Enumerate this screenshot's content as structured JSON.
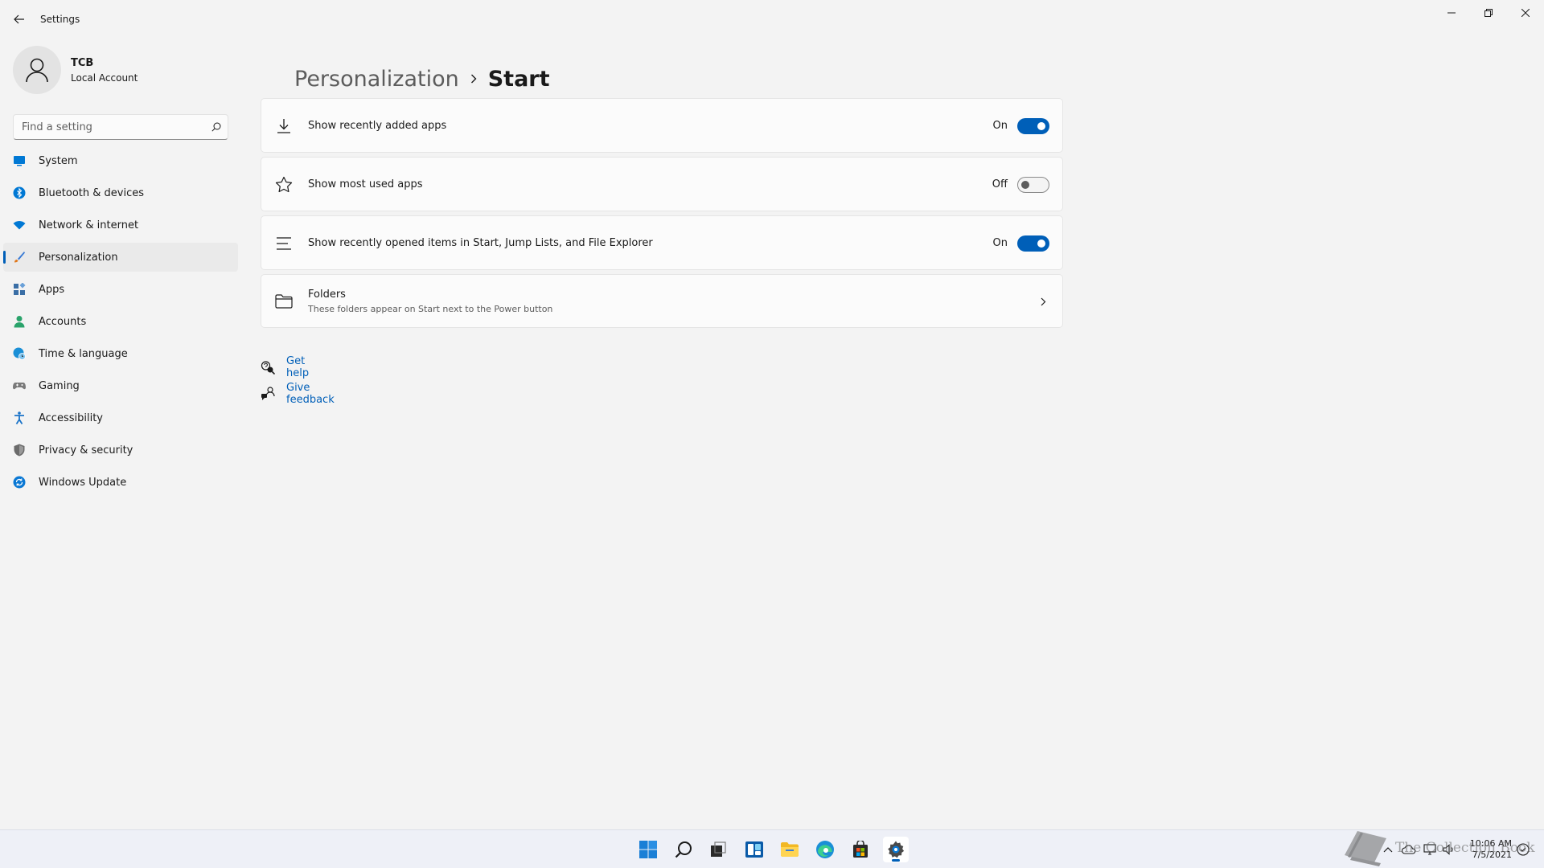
{
  "window": {
    "title": "Settings"
  },
  "account": {
    "name": "TCB",
    "type": "Local Account"
  },
  "search": {
    "placeholder": "Find a setting"
  },
  "sidebar": {
    "items": [
      {
        "label": "System",
        "icon": "monitor-icon",
        "color": "#0078d4"
      },
      {
        "label": "Bluetooth & devices",
        "icon": "bluetooth-icon",
        "color": "#0078d4"
      },
      {
        "label": "Network & internet",
        "icon": "wifi-icon",
        "color": "#0078d4"
      },
      {
        "label": "Personalization",
        "icon": "brush-icon",
        "color": "#e0781c",
        "active": true
      },
      {
        "label": "Apps",
        "icon": "apps-icon",
        "color": "#3a6ea5"
      },
      {
        "label": "Accounts",
        "icon": "person-icon",
        "color": "#2aa36b"
      },
      {
        "label": "Time & language",
        "icon": "globe-clock-icon",
        "color": "#1a8fd6"
      },
      {
        "label": "Gaming",
        "icon": "gamepad-icon",
        "color": "#7a7a7a"
      },
      {
        "label": "Accessibility",
        "icon": "accessibility-icon",
        "color": "#1a73c8"
      },
      {
        "label": "Privacy & security",
        "icon": "shield-icon",
        "color": "#6b6b6b"
      },
      {
        "label": "Windows Update",
        "icon": "update-icon",
        "color": "#0a78d4"
      }
    ]
  },
  "breadcrumb": {
    "parent": "Personalization",
    "current": "Start"
  },
  "settings": {
    "recent_apps": {
      "label": "Show recently added apps",
      "state": "On",
      "enabled": true,
      "icon": "download-icon"
    },
    "most_used": {
      "label": "Show most used apps",
      "state": "Off",
      "enabled": false,
      "icon": "star-icon"
    },
    "recent_items": {
      "label": "Show recently opened items in Start, Jump Lists, and File Explorer",
      "state": "On",
      "enabled": true,
      "icon": "list-icon"
    },
    "folders": {
      "label": "Folders",
      "description": "These folders appear on Start next to the Power button",
      "icon": "folder-icon"
    }
  },
  "links": {
    "help": "Get help",
    "feedback": "Give feedback"
  },
  "taskbar": {
    "time": "10:06 AM",
    "date": "7/5/2021",
    "watermark": "The Collection Book"
  },
  "colors": {
    "accent": "#005fb8",
    "background": "#f3f3f3",
    "card": "#fbfbfb"
  }
}
